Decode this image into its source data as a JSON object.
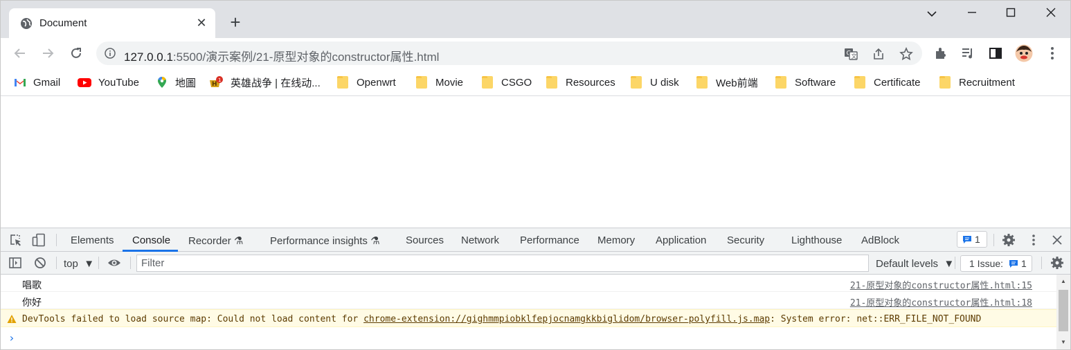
{
  "browser": {
    "tab": {
      "title": "Document"
    },
    "address": {
      "host": "127.0.0.1",
      "rest": ":5500/演示案例/21-原型对象的constructor属性.html"
    }
  },
  "bookmarks": [
    {
      "label": "Gmail",
      "icon": "gmail-icon"
    },
    {
      "label": "YouTube",
      "icon": "youtube-icon"
    },
    {
      "label": "地圖",
      "icon": "maps-icon"
    },
    {
      "label": "英雄战争 | 在线动...",
      "icon": "game-icon"
    },
    {
      "label": "Openwrt",
      "icon": "folder-icon"
    },
    {
      "label": "Movie",
      "icon": "folder-icon"
    },
    {
      "label": "CSGO",
      "icon": "folder-icon"
    },
    {
      "label": "Resources",
      "icon": "folder-icon"
    },
    {
      "label": "U disk",
      "icon": "folder-icon"
    },
    {
      "label": "Web前端",
      "icon": "folder-icon"
    },
    {
      "label": "Software",
      "icon": "folder-icon"
    },
    {
      "label": "Certificate",
      "icon": "folder-icon"
    },
    {
      "label": "Recruitment",
      "icon": "folder-icon"
    }
  ],
  "devtools": {
    "tabs": [
      "Elements",
      "Console",
      "Recorder",
      "Performance insights",
      "Sources",
      "Network",
      "Performance",
      "Memory",
      "Application",
      "Security",
      "Lighthouse",
      "AdBlock"
    ],
    "active_tab": "Console",
    "issues_count": "1",
    "toolbar": {
      "context": "top",
      "filter_placeholder": "Filter",
      "levels": "Default levels",
      "issue_label": "1 Issue:",
      "issue_count": "1"
    },
    "console": {
      "logs": [
        {
          "message": "唱歌",
          "source": "21-原型对象的constructor属性.html:15"
        },
        {
          "message": "你好",
          "source": "21-原型对象的constructor属性.html:18"
        }
      ],
      "warning": {
        "prefix": "DevTools failed to load source map: Could not load content for ",
        "link": "chrome-extension://gighmmpiobklfepjocnamgkkbiglidom/browser-polyfill.js.map",
        "suffix": ": System error: net::ERR_FILE_NOT_FOUND"
      },
      "prompt": "›"
    }
  },
  "colors": {
    "accent": "#1a73e8",
    "tabstrip": "#dfe1e5",
    "warning_bg": "#fffbe5"
  }
}
